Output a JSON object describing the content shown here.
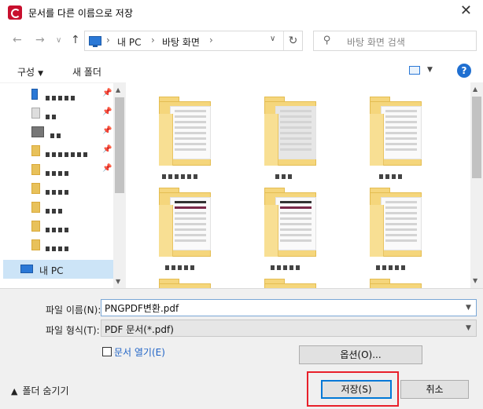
{
  "window": {
    "title": "문서를 다른 이름으로 저장",
    "close_glyph": "✕"
  },
  "nav": {
    "back_glyph": "←",
    "forward_glyph": "→",
    "dropdown_glyph": "∨",
    "up_glyph": "↑",
    "breadcrumb": [
      "내 PC",
      "바탕 화면"
    ],
    "breadcrumb_sep": "›",
    "refresh_glyph": "↻",
    "search_placeholder": "바탕 화면 검색"
  },
  "toolbar": {
    "organize_label": "구성",
    "new_folder_label": "새 폴더",
    "help_glyph": "?"
  },
  "sidebar": {
    "this_pc_label": "내 PC"
  },
  "form": {
    "filename_label": "파일 이름(N):",
    "filename_value": "PNGPDF변환.pdf",
    "filetype_label": "파일 형식(T):",
    "filetype_value": "PDF 문서(*.pdf)",
    "open_doc_label": "문서 열기(E)",
    "options_label": "옵션(O)...",
    "hide_folders_label": "폴더 숨기기",
    "save_label": "저장(S)",
    "cancel_label": "취소"
  }
}
